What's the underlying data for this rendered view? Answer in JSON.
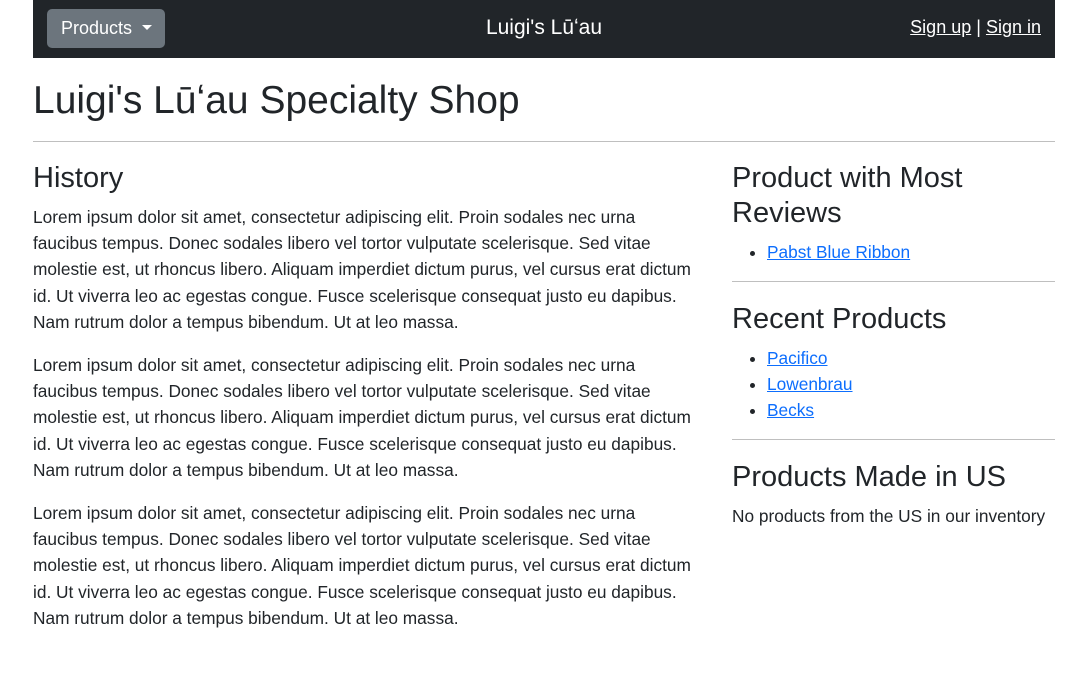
{
  "navbar": {
    "dropdown_label": "Products",
    "brand": "Luigi's Lūʻau",
    "sign_up": "Sign up",
    "separator": "|",
    "sign_in": "Sign in"
  },
  "page": {
    "title": "Luigi's Lūʻau Specialty Shop"
  },
  "main": {
    "history_heading": "History",
    "paragraphs": [
      "Lorem ipsum dolor sit amet, consectetur adipiscing elit. Proin sodales nec urna faucibus tempus. Donec sodales libero vel tortor vulputate scelerisque. Sed vitae molestie est, ut rhoncus libero. Aliquam imperdiet dictum purus, vel cursus erat dictum id. Ut viverra leo ac egestas congue. Fusce scelerisque consequat justo eu dapibus. Nam rutrum dolor a tempus bibendum. Ut at leo massa.",
      "Lorem ipsum dolor sit amet, consectetur adipiscing elit. Proin sodales nec urna faucibus tempus. Donec sodales libero vel tortor vulputate scelerisque. Sed vitae molestie est, ut rhoncus libero. Aliquam imperdiet dictum purus, vel cursus erat dictum id. Ut viverra leo ac egestas congue. Fusce scelerisque consequat justo eu dapibus. Nam rutrum dolor a tempus bibendum. Ut at leo massa.",
      "Lorem ipsum dolor sit amet, consectetur adipiscing elit. Proin sodales nec urna faucibus tempus. Donec sodales libero vel tortor vulputate scelerisque. Sed vitae molestie est, ut rhoncus libero. Aliquam imperdiet dictum purus, vel cursus erat dictum id. Ut viverra leo ac egestas congue. Fusce scelerisque consequat justo eu dapibus. Nam rutrum dolor a tempus bibendum. Ut at leo massa."
    ]
  },
  "sidebar": {
    "most_reviews_heading": "Product with Most Reviews",
    "most_reviews_items": [
      "Pabst Blue Ribbon"
    ],
    "recent_heading": "Recent Products",
    "recent_items": [
      "Pacifico",
      "Lowenbrau",
      "Becks"
    ],
    "us_heading": "Products Made in US",
    "us_empty_text": "No products from the US in our inventory"
  },
  "colors": {
    "navbar_bg": "#212529",
    "dropdown_bg": "#6c757d",
    "link": "#0d6efd"
  }
}
